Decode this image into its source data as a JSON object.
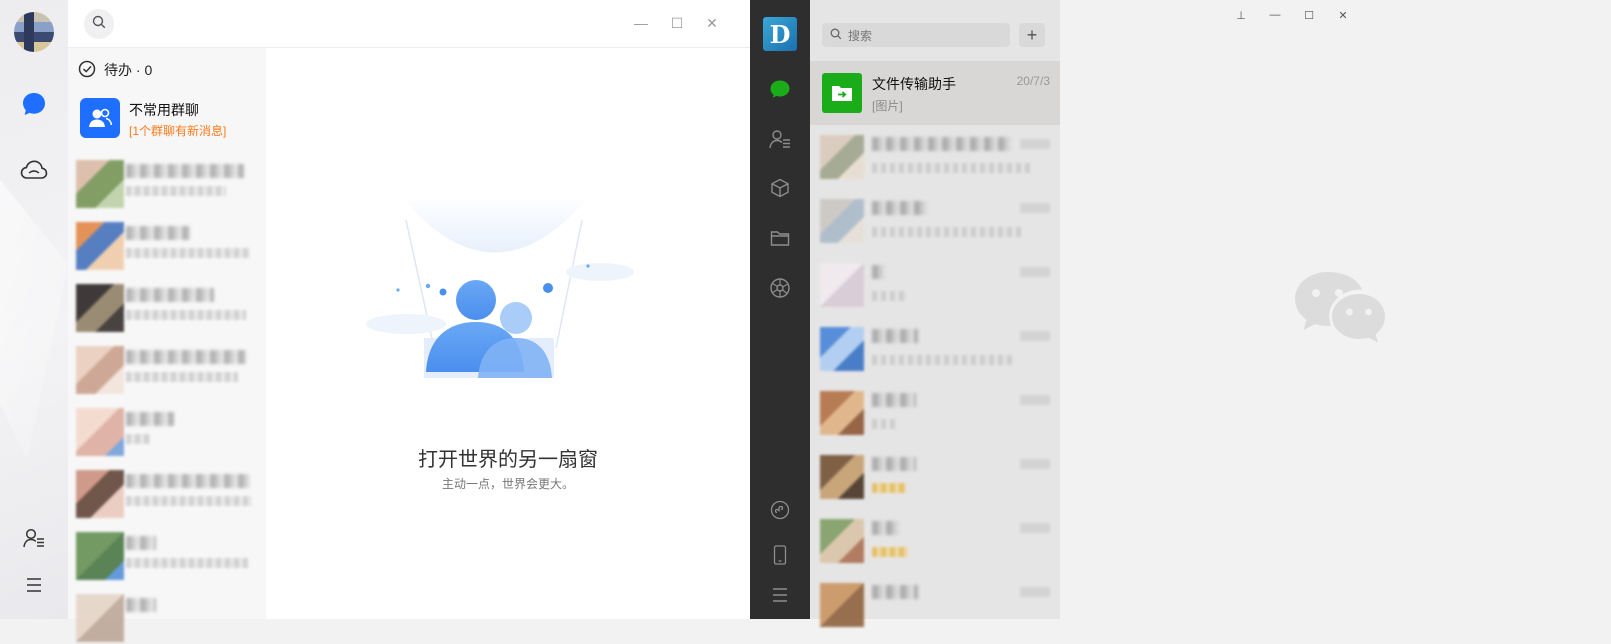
{
  "qq": {
    "todo_label": "待办 · 0",
    "group": {
      "title": "不常用群聊",
      "subtitle": "[1个群聊有新消息]"
    },
    "window_controls": {
      "minimize": "—",
      "maximize": "☐",
      "close": "✕"
    },
    "empty_state": {
      "title": "打开世界的另一扇窗",
      "subtitle": "主动一点，世界会更大。"
    },
    "colors": {
      "accent": "#1e6fff",
      "highlight": "#ff7a1a"
    }
  },
  "wechat": {
    "search_placeholder": "搜索",
    "add_button": "+",
    "active_chat": {
      "name": "文件传输助手",
      "date": "20/7/3",
      "preview": "[图片]"
    },
    "window_controls": {
      "pin": "⊥",
      "minimize": "—",
      "maximize": "☐",
      "close": "✕"
    },
    "colors": {
      "accent": "#1aad19",
      "sidebar": "#2e2e2e"
    }
  }
}
